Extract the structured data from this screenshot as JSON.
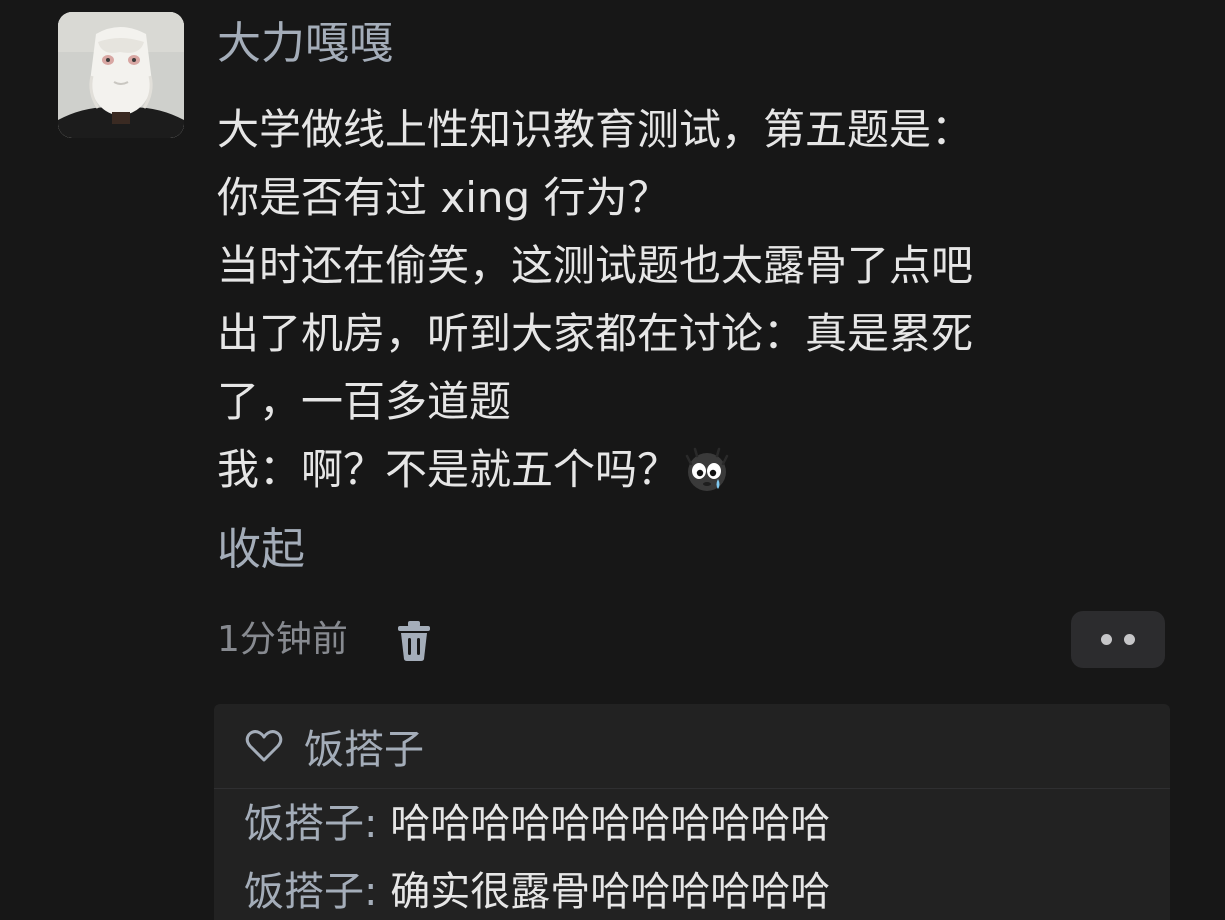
{
  "post": {
    "author": "大力嘎嘎",
    "lines": [
      "大学做线上性知识教育测试，第五题是：",
      "你是否有过 xing 行为？",
      "当时还在偷笑，这测试题也太露骨了点吧",
      "出了机房，听到大家都在讨论：真是累死",
      "了，一百多道题",
      "我：啊？不是就五个吗？"
    ],
    "emoji_icon": "crying-face-icon",
    "collapse_label": "收起",
    "timestamp": "1分钟前"
  },
  "likes": {
    "names": "饭搭子"
  },
  "replies": [
    {
      "name": "饭搭子",
      "separator": ": ",
      "content": "哈哈哈哈哈哈哈哈哈哈哈"
    },
    {
      "name": "饭搭子",
      "separator": ": ",
      "content": "确实很露骨哈哈哈哈哈哈"
    }
  ],
  "colors": {
    "background": "#171717",
    "name_color": "#a4adb9",
    "text_color": "#e6e6e6",
    "panel_background": "#222222"
  }
}
